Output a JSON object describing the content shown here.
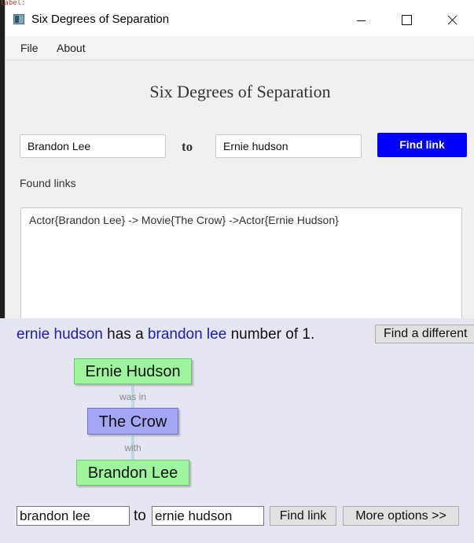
{
  "background_code": "label;",
  "window": {
    "title": "Six Degrees of Separation",
    "menu": [
      "File",
      "About"
    ]
  },
  "app": {
    "heading": "Six Degrees of Separation",
    "from_value": "Brandon Lee",
    "to_label": "to",
    "to_value": "Ernie hudson",
    "find_button": "Find link",
    "found_label": "Found links",
    "result_text": "Actor{Brandon Lee} -> Movie{The Crow} ->Actor{Ernie Hudson}"
  },
  "web": {
    "sentence": {
      "name_a": "ernie hudson",
      "mid": " has a ",
      "name_b": "brandon lee",
      "tail": " number of 1."
    },
    "find_different_button": "Find a different",
    "graph": {
      "nodes": [
        {
          "label": "Ernie Hudson",
          "kind": "actor"
        },
        {
          "label": "The Crow",
          "kind": "movie"
        },
        {
          "label": "Brandon Lee",
          "kind": "actor"
        }
      ],
      "edges": [
        "was in",
        "with"
      ]
    },
    "form": {
      "from_value": "brandon lee",
      "to_label": "to",
      "to_value": "ernie hudson",
      "find_button": "Find link",
      "options_button": "More options >>"
    },
    "colors": {
      "actor_node": "#9ef59e",
      "movie_node": "#a5a5f5",
      "name_link": "#1a1acc"
    }
  }
}
